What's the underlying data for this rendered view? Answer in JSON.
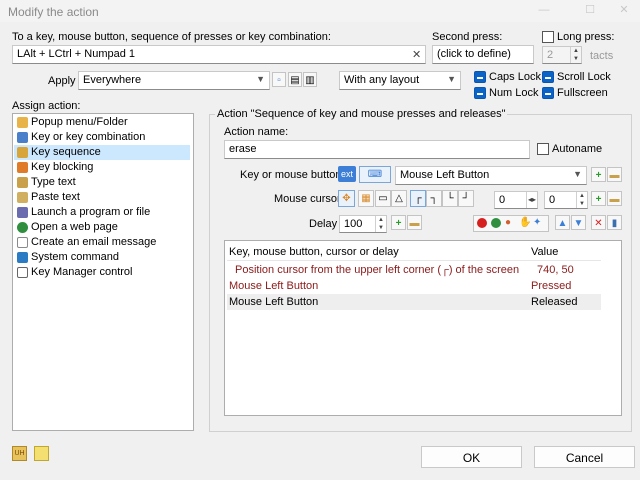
{
  "window": {
    "title": "Modify the action",
    "min_glyph": "—",
    "max_glyph": "☐",
    "close_glyph": "✕"
  },
  "trigger": {
    "label": "To a key, mouse button, sequence of presses or key combination:",
    "value": "LAlt + LCtrl + Numpad 1",
    "clear_glyph": "✕"
  },
  "second_press": {
    "label": "Second press:",
    "value": "(click to define)"
  },
  "long_press": {
    "label": "Long press:",
    "value": "2",
    "unit": "tacts"
  },
  "apply": {
    "label": "Apply",
    "value": "Everywhere",
    "layout_value": "With any layout"
  },
  "locks": {
    "caps": "Caps Lock",
    "scroll": "Scroll Lock",
    "num": "Num Lock",
    "fullscreen": "Fullscreen"
  },
  "assign": {
    "label": "Assign action:",
    "items": [
      {
        "label": "Popup menu/Folder",
        "color": "#e8b44a"
      },
      {
        "label": "Key or key combination",
        "color": "#4a7fc9"
      },
      {
        "label": "Key sequence",
        "color": "#d8a53a"
      },
      {
        "label": "Key blocking",
        "color": "#e07b2a"
      },
      {
        "label": "Type text",
        "color": "#c9a14a"
      },
      {
        "label": "Paste text",
        "color": "#d0b060"
      },
      {
        "label": "Launch a program or file",
        "color": "#6b6bb0"
      },
      {
        "label": "Open a web page",
        "color": "#2f8f3f"
      },
      {
        "label": "Create an email message",
        "color": "#8a8a8a"
      },
      {
        "label": "System command",
        "color": "#2b7bc4"
      },
      {
        "label": "Key Manager control",
        "color": "#666666"
      }
    ]
  },
  "action": {
    "group_label": "Action \"Sequence of key and mouse presses and releases\"",
    "name_label": "Action name:",
    "name_value": "erase",
    "autoname": "Autoname",
    "key_label": "Key or mouse button",
    "ext": "ext",
    "key_value": "Mouse Left Button",
    "cursor_label": "Mouse cursor",
    "cursor_x": "0",
    "cursor_y": "0",
    "delay_label": "Delay",
    "delay_value": "100"
  },
  "table": {
    "col_key": "Key, mouse button, cursor or delay",
    "col_value": "Value",
    "rows": [
      {
        "key": "Position cursor from the upper left corner (┌) of the screen",
        "value": "740, 50"
      },
      {
        "key": "Mouse Left Button",
        "value": "Pressed"
      },
      {
        "key": "Mouse Left Button",
        "value": "Released"
      }
    ]
  },
  "buttons": {
    "ok": "OK",
    "cancel": "Cancel"
  },
  "colors": {
    "accent": "#0a64c8",
    "selection": "#cce8ff",
    "row_text": "#8b1a1a"
  }
}
